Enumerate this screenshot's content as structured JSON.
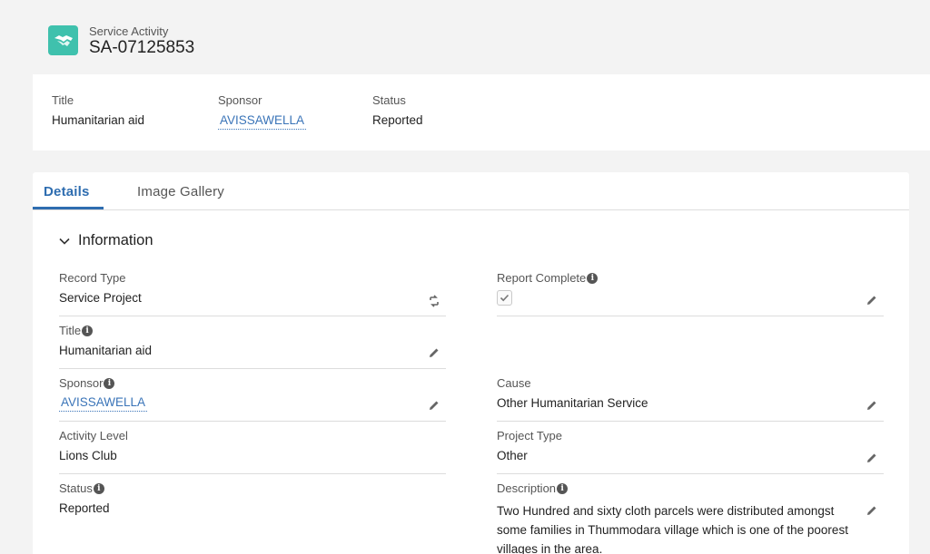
{
  "header": {
    "object_type": "Service Activity",
    "record_number": "SA-07125853",
    "icon": "handshake-icon",
    "accent_color": "#3fc1ad"
  },
  "highlights": {
    "title_label": "Title",
    "title_value": "Humanitarian aid",
    "sponsor_label": "Sponsor",
    "sponsor_value": "AVISSAWELLA",
    "status_label": "Status",
    "status_value": "Reported"
  },
  "tabs": {
    "details": "Details",
    "image_gallery": "Image Gallery",
    "active": "Details"
  },
  "section": {
    "title": "Information",
    "fields": {
      "record_type": {
        "label": "Record Type",
        "value": "Service Project"
      },
      "report_complete": {
        "label": "Report Complete",
        "checked": true
      },
      "title": {
        "label": "Title",
        "value": "Humanitarian aid"
      },
      "sponsor": {
        "label": "Sponsor",
        "value": "AVISSAWELLA"
      },
      "cause": {
        "label": "Cause",
        "value": "Other Humanitarian Service"
      },
      "activity_level": {
        "label": "Activity Level",
        "value": "Lions Club"
      },
      "project_type": {
        "label": "Project Type",
        "value": "Other"
      },
      "status": {
        "label": "Status",
        "value": "Reported"
      },
      "description": {
        "label": "Description",
        "value": "Two Hundred and sixty cloth parcels were distributed amongst some families in Thummodara village which is one of the poorest villages in the area."
      }
    }
  },
  "colors": {
    "link": "#3a74b8",
    "tab_active": "#2e6db0"
  }
}
